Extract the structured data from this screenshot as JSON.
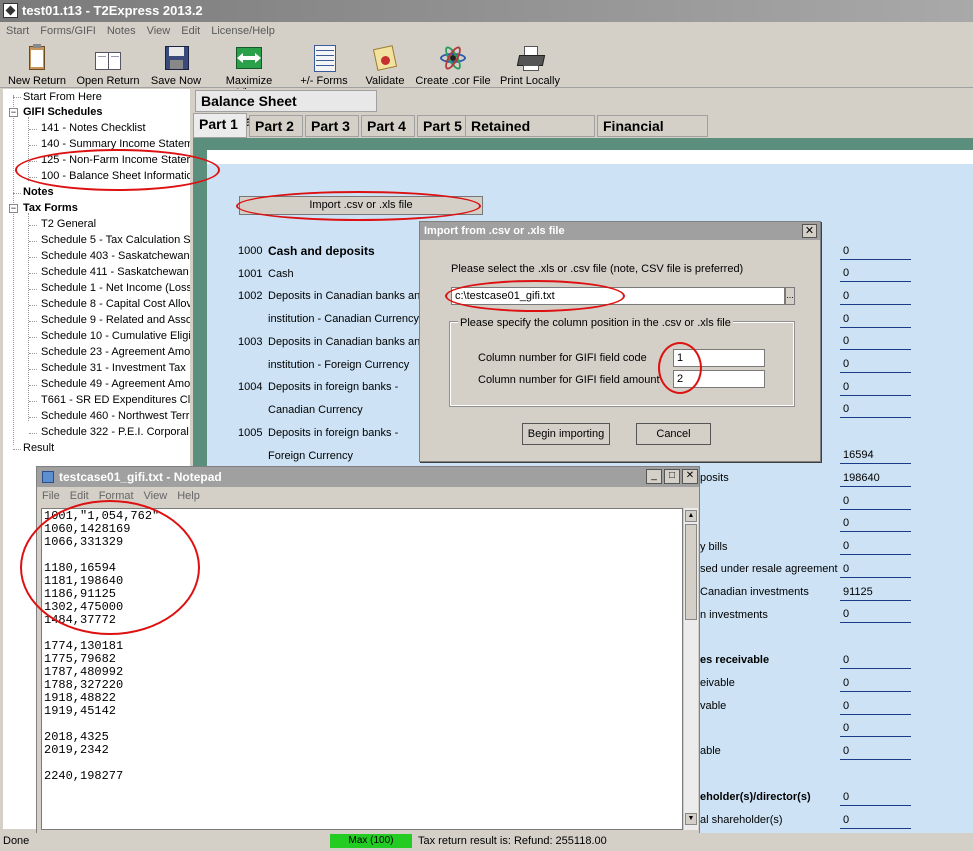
{
  "window": {
    "title": "test01.t13 - T2Express 2013.2"
  },
  "menu": [
    "Start",
    "Forms/GIFI",
    "Notes",
    "View",
    "Edit",
    "License/Help"
  ],
  "toolbar": [
    {
      "label": "New Return",
      "icon": "clipboard-icon"
    },
    {
      "label": "Open Return",
      "icon": "open-book-icon"
    },
    {
      "label": "Save Now",
      "icon": "floppy-disk-icon"
    },
    {
      "label": "Maximize View",
      "icon": "maximize-icon"
    },
    {
      "label": "+/- Forms",
      "icon": "forms-list-icon"
    },
    {
      "label": "Validate",
      "icon": "validate-certificate-icon"
    },
    {
      "label": "Create .cor File",
      "icon": "atom-icon"
    },
    {
      "label": "Print Locally",
      "icon": "printer-icon"
    }
  ],
  "tree": {
    "start": "Start From Here",
    "gifi_header": "GIFI Schedules",
    "gifi_items": [
      "141 - Notes Checklist",
      "140 - Summary Income Statem",
      "125 - Non-Farm Income Stater",
      "100 - Balance Sheet Informatic"
    ],
    "notes": "Notes",
    "tax_header": "Tax Forms",
    "tax_items": [
      "T2 General",
      "Schedule 5 - Tax Calculation Sι",
      "Schedule 403 - Saskatchewan",
      "Schedule 411 - Saskatchewan",
      "Schedule 1 - Net Income (Loss",
      "Schedule 8 - Capital Cost Allov",
      "Schedule 9 - Related and Asso",
      "Schedule 10 - Cumulative Eligit",
      "Schedule 23 - Agreement Amo",
      "Schedule 31 - Investment Tax",
      "Schedule 49 - Agreement Amo",
      "T661 - SR ED Expenditures Cla",
      "Schedule 460 - Northwest Terr",
      "Schedule 322 - P.E.I. Corporal"
    ],
    "result": "Result"
  },
  "section_tab": "Balance Sheet Information",
  "part_tabs": [
    "Part 1",
    "Part 2",
    "Part 3",
    "Part 4",
    "Part 5",
    "Retained Earnings",
    "Financial Notes"
  ],
  "import_button": "Import .csv or .xls file",
  "form_rows": [
    {
      "code": "1000",
      "label": "Cash and deposits",
      "bold": true
    },
    {
      "code": "1001",
      "label": "Cash"
    },
    {
      "code": "1002",
      "label": "Deposits in Canadian banks anc"
    },
    {
      "code": "",
      "label": "institution - Canadian Currency"
    },
    {
      "code": "1003",
      "label": "Deposits in Canadian banks anc"
    },
    {
      "code": "",
      "label": "institution - Foreign Currency"
    },
    {
      "code": "1004",
      "label": "Deposits in foreign banks -"
    },
    {
      "code": "",
      "label": "Canadian Currency"
    },
    {
      "code": "1005",
      "label": "Deposits in foreign banks -"
    },
    {
      "code": "",
      "label": "Foreign Currency"
    }
  ],
  "values": [
    "0",
    "0",
    "0",
    "0",
    "0",
    "0",
    "0",
    "0",
    "16594",
    "198640",
    "0",
    "0",
    "0",
    "0",
    "91125",
    "0",
    "0",
    "0",
    "0",
    "0",
    "0",
    "0",
    "0",
    "0"
  ],
  "peek_labels": [
    {
      "text": "posits",
      "bold": false
    },
    {
      "text": "y bills",
      "bold": false
    },
    {
      "text": "sed under resale agreement",
      "bold": false
    },
    {
      "text": "Canadian investments",
      "bold": false
    },
    {
      "text": "n investments",
      "bold": false
    },
    {
      "text": "es receivable",
      "bold": true
    },
    {
      "text": "eivable",
      "bold": false
    },
    {
      "text": "vable",
      "bold": false
    },
    {
      "text": "able",
      "bold": false
    },
    {
      "text": "eholder(s)/director(s)",
      "bold": true
    },
    {
      "text": "al shareholder(s)",
      "bold": false
    }
  ],
  "dialog": {
    "title": "Import from .csv or .xls file",
    "prompt": "Please select the .xls or .csv file (note, CSV file is preferred)",
    "file_path": "c:\\testcase01_gifi.txt",
    "browse": "...",
    "group_label": "Please specify the column position in the .csv or .xls file",
    "code_label": "Column number for GIFI field code",
    "code_value": "1",
    "amount_label": "Column number for GIFI field amount",
    "amount_value": "2",
    "begin_button": "Begin importing",
    "cancel_button": "Cancel"
  },
  "notepad": {
    "title": "testcase01_gifi.txt - Notepad",
    "menu": [
      "File",
      "Edit",
      "Format",
      "View",
      "Help"
    ],
    "content": "1001,\"1,054,762\"\n1060,1428169\n1066,331329\n\n1180,16594\n1181,198640\n1186,91125\n1302,475000\n1484,37772\n\n1774,130181\n1775,79682\n1787,480992\n1788,327220\n1918,48822\n1919,45142\n\n2018,4325\n2019,2342\n\n2240,198277"
  },
  "status": {
    "left": "Done",
    "progress": "Max (100)",
    "message": "Tax return result is: Refund: 255118.00"
  }
}
